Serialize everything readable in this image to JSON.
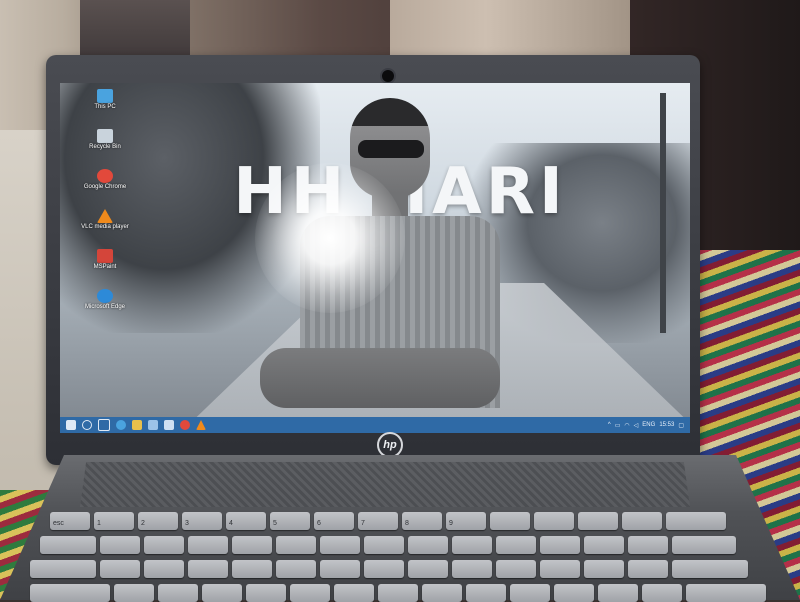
{
  "wallpaper": {
    "text": "HH HARI"
  },
  "desktop_icons": [
    {
      "label": "This PC",
      "icon": "this-pc-icon",
      "color": "#4aa3df"
    },
    {
      "label": "Recycle Bin",
      "icon": "recycle-bin-icon",
      "color": "#c9d3dc"
    },
    {
      "label": "Google Chrome",
      "icon": "chrome-icon",
      "color": "#e2493b"
    },
    {
      "label": "VLC media player",
      "icon": "vlc-icon",
      "color": "#f08a1c"
    },
    {
      "label": "MSPaint",
      "icon": "paint-icon",
      "color": "#d4453a"
    },
    {
      "label": "Microsoft Edge",
      "icon": "edge-icon",
      "color": "#2d8ad8"
    }
  ],
  "taskbar": {
    "language": "ENG",
    "clock": "15:53"
  },
  "laptop": {
    "brand": "hp"
  },
  "keyboard": {
    "row_labels": [
      "esc",
      "1",
      "2",
      "3",
      "4",
      "5",
      "6",
      "7",
      "8",
      "9"
    ]
  }
}
